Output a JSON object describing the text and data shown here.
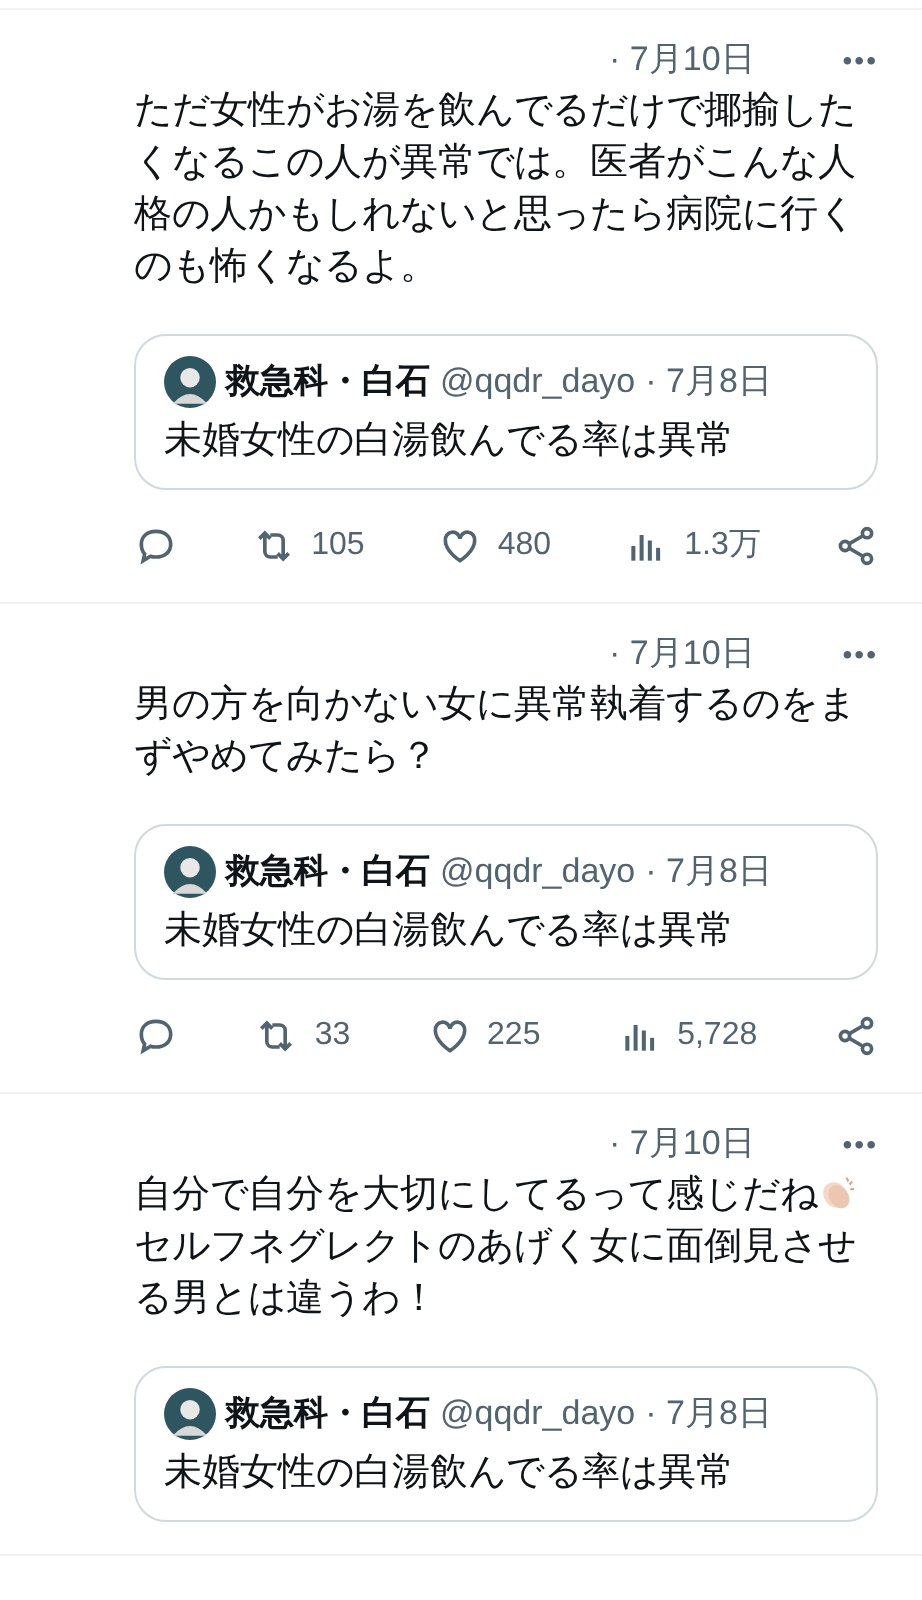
{
  "posts": [
    {
      "date": "· 7月10日",
      "more": "•••",
      "text": "ただ女性がお湯を飲んでるだけで揶揄したくなるこの人が異常では。医者がこんな人格の人かもしれないと思ったら病院に行くのも怖くなるよ。",
      "clap_emoji": false,
      "quote": {
        "name": "救急科・白石",
        "handle": "@qqdr_dayo",
        "date": "· 7月8日",
        "text": "未婚女性の白湯飲んでる率は異常"
      },
      "retweets": "105",
      "likes": "480",
      "views": "1.3万"
    },
    {
      "date": "· 7月10日",
      "more": "•••",
      "text": "男の方を向かない女に異常執着するのをまずやめてみたら？",
      "clap_emoji": false,
      "quote": {
        "name": "救急科・白石",
        "handle": "@qqdr_dayo",
        "date": "· 7月8日",
        "text": "未婚女性の白湯飲んでる率は異常"
      },
      "retweets": "33",
      "likes": "225",
      "views": "5,728"
    },
    {
      "date": "· 7月10日",
      "more": "•••",
      "text": "自分で自分を大切にしてるって感じだね",
      "clap_emoji": true,
      "text_after": "セルフネグレクトのあげく女に面倒見させる男とは違うわ！",
      "quote": {
        "name": "救急科・白石",
        "handle": "@qqdr_dayo",
        "date": "· 7月8日",
        "text": "未婚女性の白湯飲んでる率は異常"
      }
    }
  ]
}
